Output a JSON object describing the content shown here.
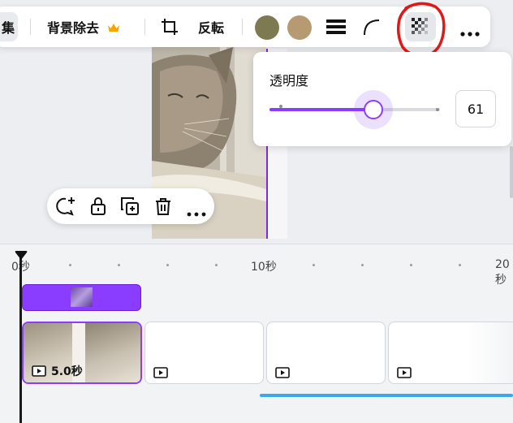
{
  "toolbar": {
    "edit_label": "集",
    "bg_remove_label": "背景除去",
    "crop_icon": "crop-icon",
    "flip_label": "反転",
    "colors": [
      "#7d7a52",
      "#b59a72"
    ],
    "lines_icon": "line-weight-icon",
    "corner_icon": "corner-rounding-icon",
    "transparency_icon": "transparency-checker-icon",
    "more_icon": "more-icon",
    "crown_color": "#f4a800"
  },
  "transparency_popup": {
    "title": "透明度",
    "value": "61",
    "level_percent": 61,
    "accent": "#8b3dff"
  },
  "context_bar": {
    "icons": [
      "comment-add-icon",
      "lock-icon",
      "duplicate-icon",
      "trash-icon",
      "more-icon"
    ]
  },
  "timeline": {
    "ruler_labels": [
      "0秒",
      "10秒",
      "20秒"
    ],
    "clip_duration": "5.0秒",
    "progress_color": "#3aa8ee"
  }
}
